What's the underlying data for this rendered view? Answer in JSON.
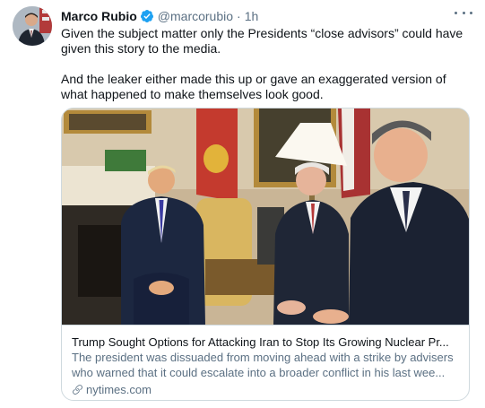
{
  "tweet": {
    "author_name": "Marco Rubio",
    "author_handle": "@marcorubio",
    "separator": "·",
    "time": "1h",
    "paragraph_1": "Given the subject matter only the Presidents “close advisors” could have given this story to the media.",
    "paragraph_2": "And the leaker either made this up or gave an exaggerated version of what happened  to make themselves look good."
  },
  "card": {
    "title": "Trump Sought Options for Attacking Iran to Stop Its Growing Nuclear Pr...",
    "description": "The president was dissuaded from moving ahead with a strike by advisers who warned that it could escalate into a broader conflict in his last wee...",
    "domain": "nytimes.com"
  },
  "icons": {
    "verified": "verified-badge-icon",
    "more": "more-options-icon",
    "link": "link-icon"
  },
  "colors": {
    "text": "#0f1419",
    "secondary": "#5b7083",
    "verified": "#1da1f2",
    "border": "#cfd9de"
  }
}
